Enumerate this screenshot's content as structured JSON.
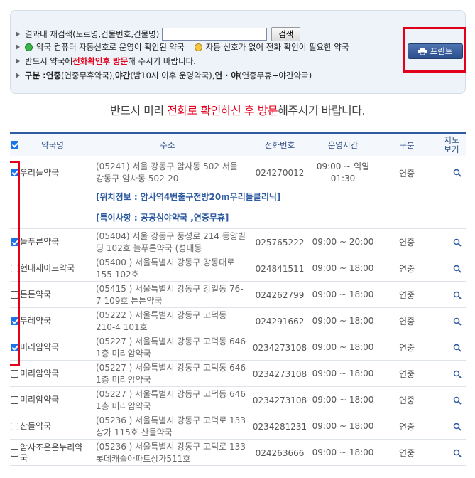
{
  "search": {
    "label": "결과내 재검색(도로명,건물번호,건물명)",
    "value": "",
    "placeholder": "",
    "button": "검색"
  },
  "legend": {
    "green_text": "약국 컴퓨터 자동신호로 운영이 확인된 약국",
    "yellow_text": "자동 신호가 없어 전화 확인이 필요한 약국"
  },
  "visit_note": {
    "prefix": "반드시 약국에 ",
    "highlight": "전화확인후 방문",
    "suffix": "해 주시기 바랍니다."
  },
  "category_note": {
    "label": "구분 : ",
    "a_b": "연중",
    "a_r": "(연중무휴약국), ",
    "b_b": "야간",
    "b_r": "(밤10시 이후 운영약국), ",
    "c_b": "연 · 야",
    "c_r": "(연중무휴+야간약국)"
  },
  "print_button": "프린트",
  "notice": {
    "prefix": "반드시 미리 ",
    "highlight": "전화로 확인하신 후 방문",
    "suffix": "해주시기 바랍니다."
  },
  "table": {
    "headers": {
      "name": "약국명",
      "address": "주소",
      "phone": "전화번호",
      "hours": "운영시간",
      "type": "구분",
      "map_l1": "지도",
      "map_l2": "보기"
    },
    "rows": [
      {
        "checked": true,
        "name": "우리들약국",
        "addr1": "(05241) 서울 강동구 암사동 502 서울",
        "addr2": "강동구 암사동 502-20",
        "phone": "024270012",
        "hours1": "09:00 ~ 익일",
        "hours2": "01:30",
        "type": "연중",
        "location": "[위치정보 : 암사역4번출구전방20m우리들클리닉]",
        "special": "[특이사항 : 공공심야약국 ,연중무휴]"
      },
      {
        "checked": true,
        "name": "늘푸른약국",
        "addr1": "(05404) 서울 강동구 풍성로 214 동양빌",
        "addr2": "딩 102호 늘푸른약국 (성내동",
        "phone": "025765222",
        "hours1": "09:00 ~ 20:00",
        "type": "연중"
      },
      {
        "checked": false,
        "name": "현대제이드약국",
        "addr1": "(05400 ) 서울특별시 강동구 강동대로",
        "addr2": "155  102호",
        "phone": "024841511",
        "hours1": "09:00 ~ 18:00",
        "type": "연중"
      },
      {
        "checked": false,
        "name": "튼튼약국",
        "addr1": "(05415 ) 서울특별시 강동구 강일동 76-",
        "addr2": "7  109호 튼튼약국",
        "phone": "024262799",
        "hours1": "09:00 ~ 18:00",
        "type": "연중"
      },
      {
        "checked": true,
        "name": "두레약국",
        "addr1": "(05222 ) 서울특별시 강동구 고덕동",
        "addr2": "210-4  101호",
        "phone": "024291662",
        "hours1": "09:00 ~ 18:00",
        "type": "연중"
      },
      {
        "checked": true,
        "name": "미리암약국",
        "addr1": "(05227 ) 서울특별시 강동구 고덕동 646",
        "addr2": " 1층 미리암약국",
        "phone": "0234273108",
        "hours1": "09:00 ~ 18:00",
        "type": "연중"
      },
      {
        "checked": false,
        "name": "미리암약국",
        "addr1": "(05227 ) 서울특별시 강동구 고덕동 646",
        "addr2": " 1층 미리암약국",
        "phone": "0234273108",
        "hours1": "09:00 ~ 18:00",
        "type": "연중"
      },
      {
        "checked": false,
        "name": "미리암약국",
        "addr1": "(05227 ) 서울특별시 강동구 고덕동 646",
        "addr2": " 1층 미리암약국",
        "phone": "0234273108",
        "hours1": "09:00 ~ 18:00",
        "type": "연중"
      },
      {
        "checked": false,
        "name": "산들약국",
        "addr1": "(05236 ) 서울특별시 강동구 고덕로 133",
        "addr2": " 상가 115호 산들약국",
        "phone": "0234281231",
        "hours1": "09:00 ~ 18:00",
        "type": "연중"
      },
      {
        "checked": false,
        "name": "암사조은온누리약",
        "name2": "국",
        "addr1": "(05236 ) 서울특별시 강동구 고덕로 133",
        "addr2": " 롯데캐슬아파트상가511호",
        "phone": "024263666",
        "hours1": "09:00 ~ 18:00",
        "type": "연중"
      }
    ]
  },
  "icons": {
    "search": "magnifier-icon",
    "print": "printer-icon",
    "legend_green": "green-dot-icon",
    "legend_yellow": "yellow-dot-icon"
  },
  "colors": {
    "accent": "#2d5aa0",
    "highlight": "#e4001b",
    "checkbox": "#1a73e8"
  }
}
